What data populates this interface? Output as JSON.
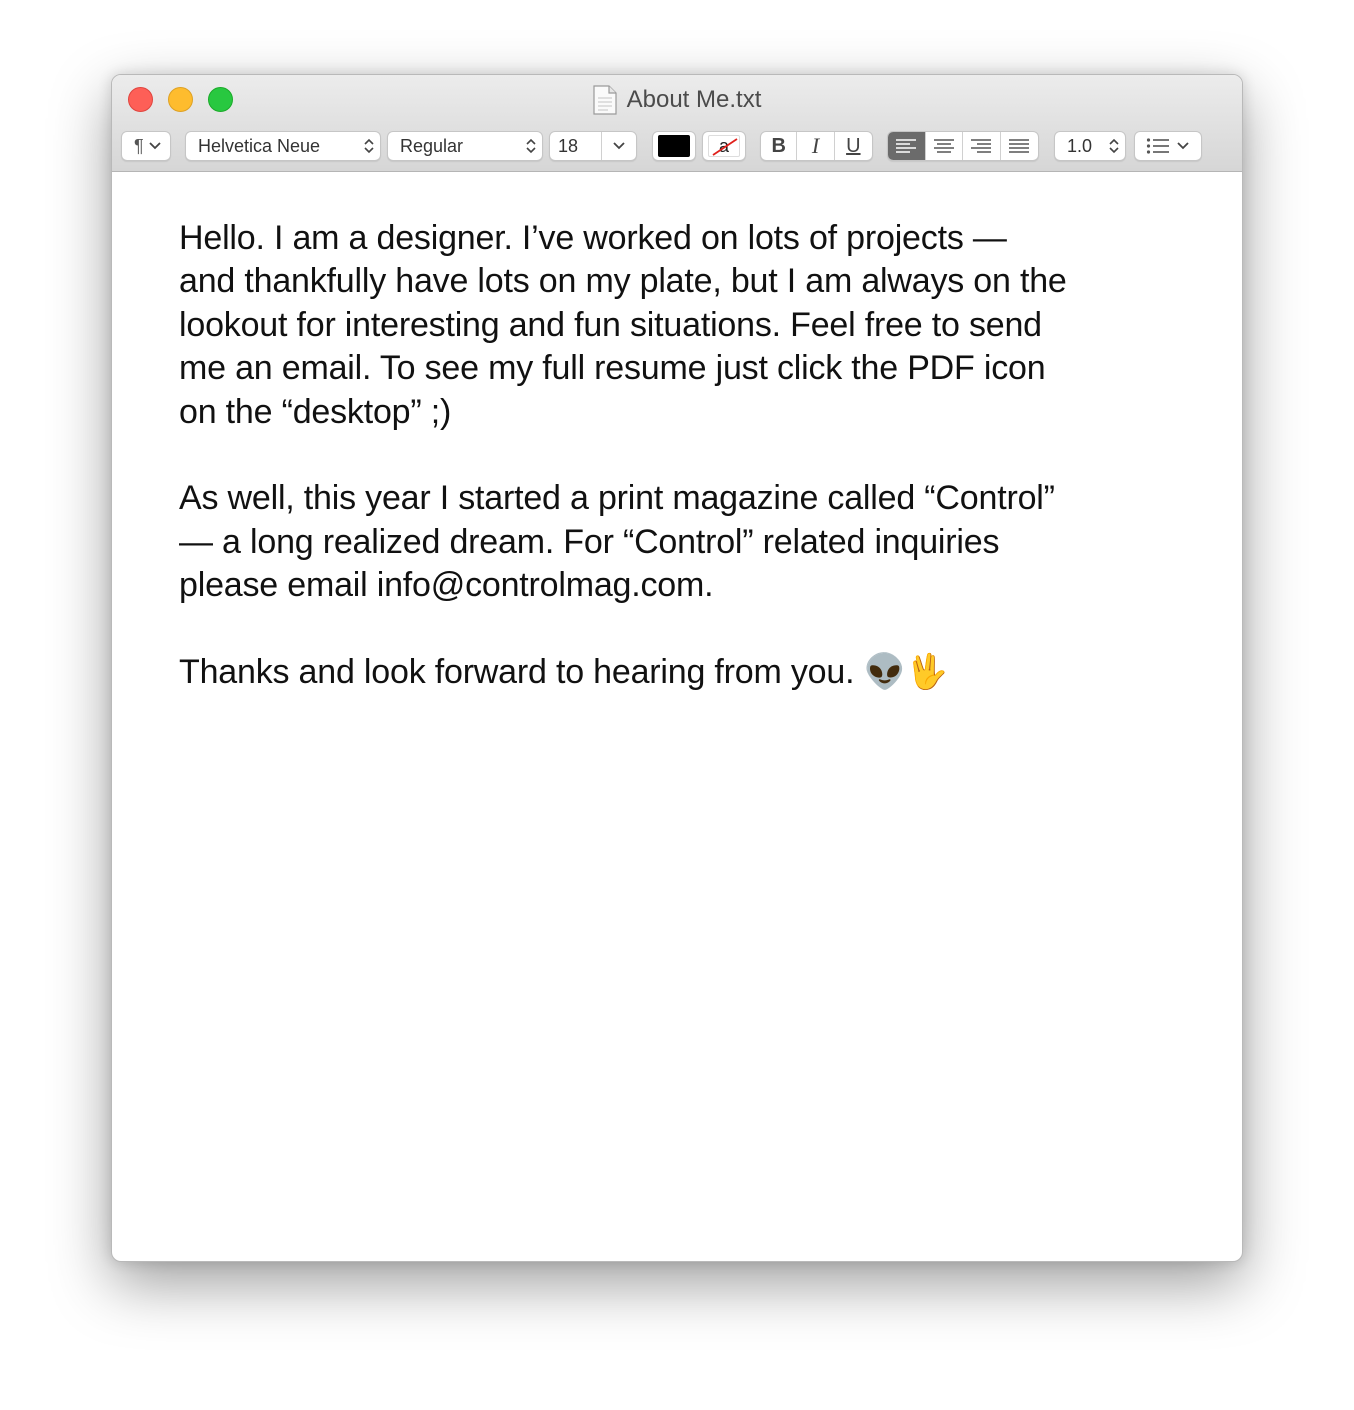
{
  "window": {
    "title": "About Me.txt"
  },
  "toolbar": {
    "paragraph_style_symbol": "¶",
    "font_family": "Helvetica Neue",
    "font_style": "Regular",
    "font_size": "18",
    "text_color": "#000000",
    "line_spacing": "1.0",
    "bold_label": "B",
    "italic_label": "I",
    "underline_label": "U",
    "bg_color_label": "a",
    "alignment_selected": "left"
  },
  "document": {
    "paragraphs": [
      "Hello. I am a designer. I’ve worked on lots of projects —\nand thankfully have lots on my plate, but I am always on the\nlookout for interesting and fun situations. Feel free to send\nme an email. To see my full resume just click the PDF icon\non the “desktop” ;)",
      "As well, this year I started a print magazine called “Control”\n— a long realized dream. For “Control” related inquiries\nplease email info@controlmag.com.",
      "Thanks and look forward to hearing from you. 👽🖖"
    ]
  }
}
